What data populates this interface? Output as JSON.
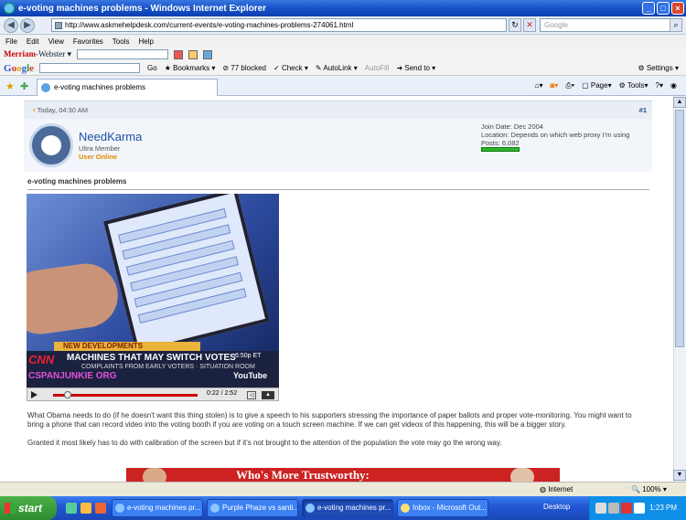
{
  "window": {
    "title": "e-voting machines problems - Windows Internet Explorer"
  },
  "address": {
    "url": "http://www.askmehelpdesk.com/current-events/e-voting-machines-problems-274061.html",
    "search_placeholder": "Google"
  },
  "menu": [
    "File",
    "Edit",
    "View",
    "Favorites",
    "Tools",
    "Help"
  ],
  "merriam": {
    "label_m": "Merriam",
    "label_w": "-Webster"
  },
  "google_toolbar": {
    "logo": "Google",
    "go": "Go",
    "bookmarks": "Bookmarks",
    "blocked": "77 blocked",
    "check": "Check",
    "autolink": "AutoLink",
    "autofill": "AutoFill",
    "sendto": "Send to",
    "settings": "Settings"
  },
  "tab": {
    "label": "e-voting machines problems"
  },
  "tab_commands": {
    "page": "Page",
    "tools": "Tools"
  },
  "post": {
    "date": "Today, 04:30 AM",
    "number": "#1",
    "user": {
      "name": "NeedKarma",
      "rank": "Ultra Member",
      "status": "User Online",
      "join": "Join Date: Dec 2004",
      "location": "Location: Depends on which web proxy I'm using",
      "posts": "Posts: 6,082"
    },
    "title": "e-voting machines problems",
    "video": {
      "banner": "NEW DEVELOPMENTS",
      "cnn": "CNN",
      "headline": "MACHINES THAT MAY SWITCH VOTES",
      "sub": "COMPLAINTS FROM EARLY VOTERS",
      "sub2": "SITUATION ROOM",
      "time_et": "6:50p ET",
      "cspan": "CSPANJUNKIE ORG",
      "tube": "YouTube",
      "timer": "0:22 / 2:52"
    },
    "paragraphs": [
      "What Obama needs to do (if he doesn't want this thing stolen) is to give a speech to his supporters stressing the importance of paper ballots and proper vote-monitoring. You might want to bring a phone that can record video into the voting booth if you are voting on a touch screen machine. If we can get videos of this happening, this will be a bigger story.",
      "Granted it most likely has to do with calibration of the screen but if it's not brought to the attention of the population the vote may go the wrong way."
    ],
    "ad_text": "Who's More Trustworthy:"
  },
  "status": {
    "zone": "Internet",
    "zoom": "100%"
  },
  "taskbar": {
    "start": "start",
    "tasks": [
      "e-voting machines pr...",
      "Purple Phaze vs santi...",
      "e-voting machines pr...",
      "Inbox - Microsoft Out..."
    ],
    "desktop": "Desktop",
    "clock": "1:23 PM"
  }
}
